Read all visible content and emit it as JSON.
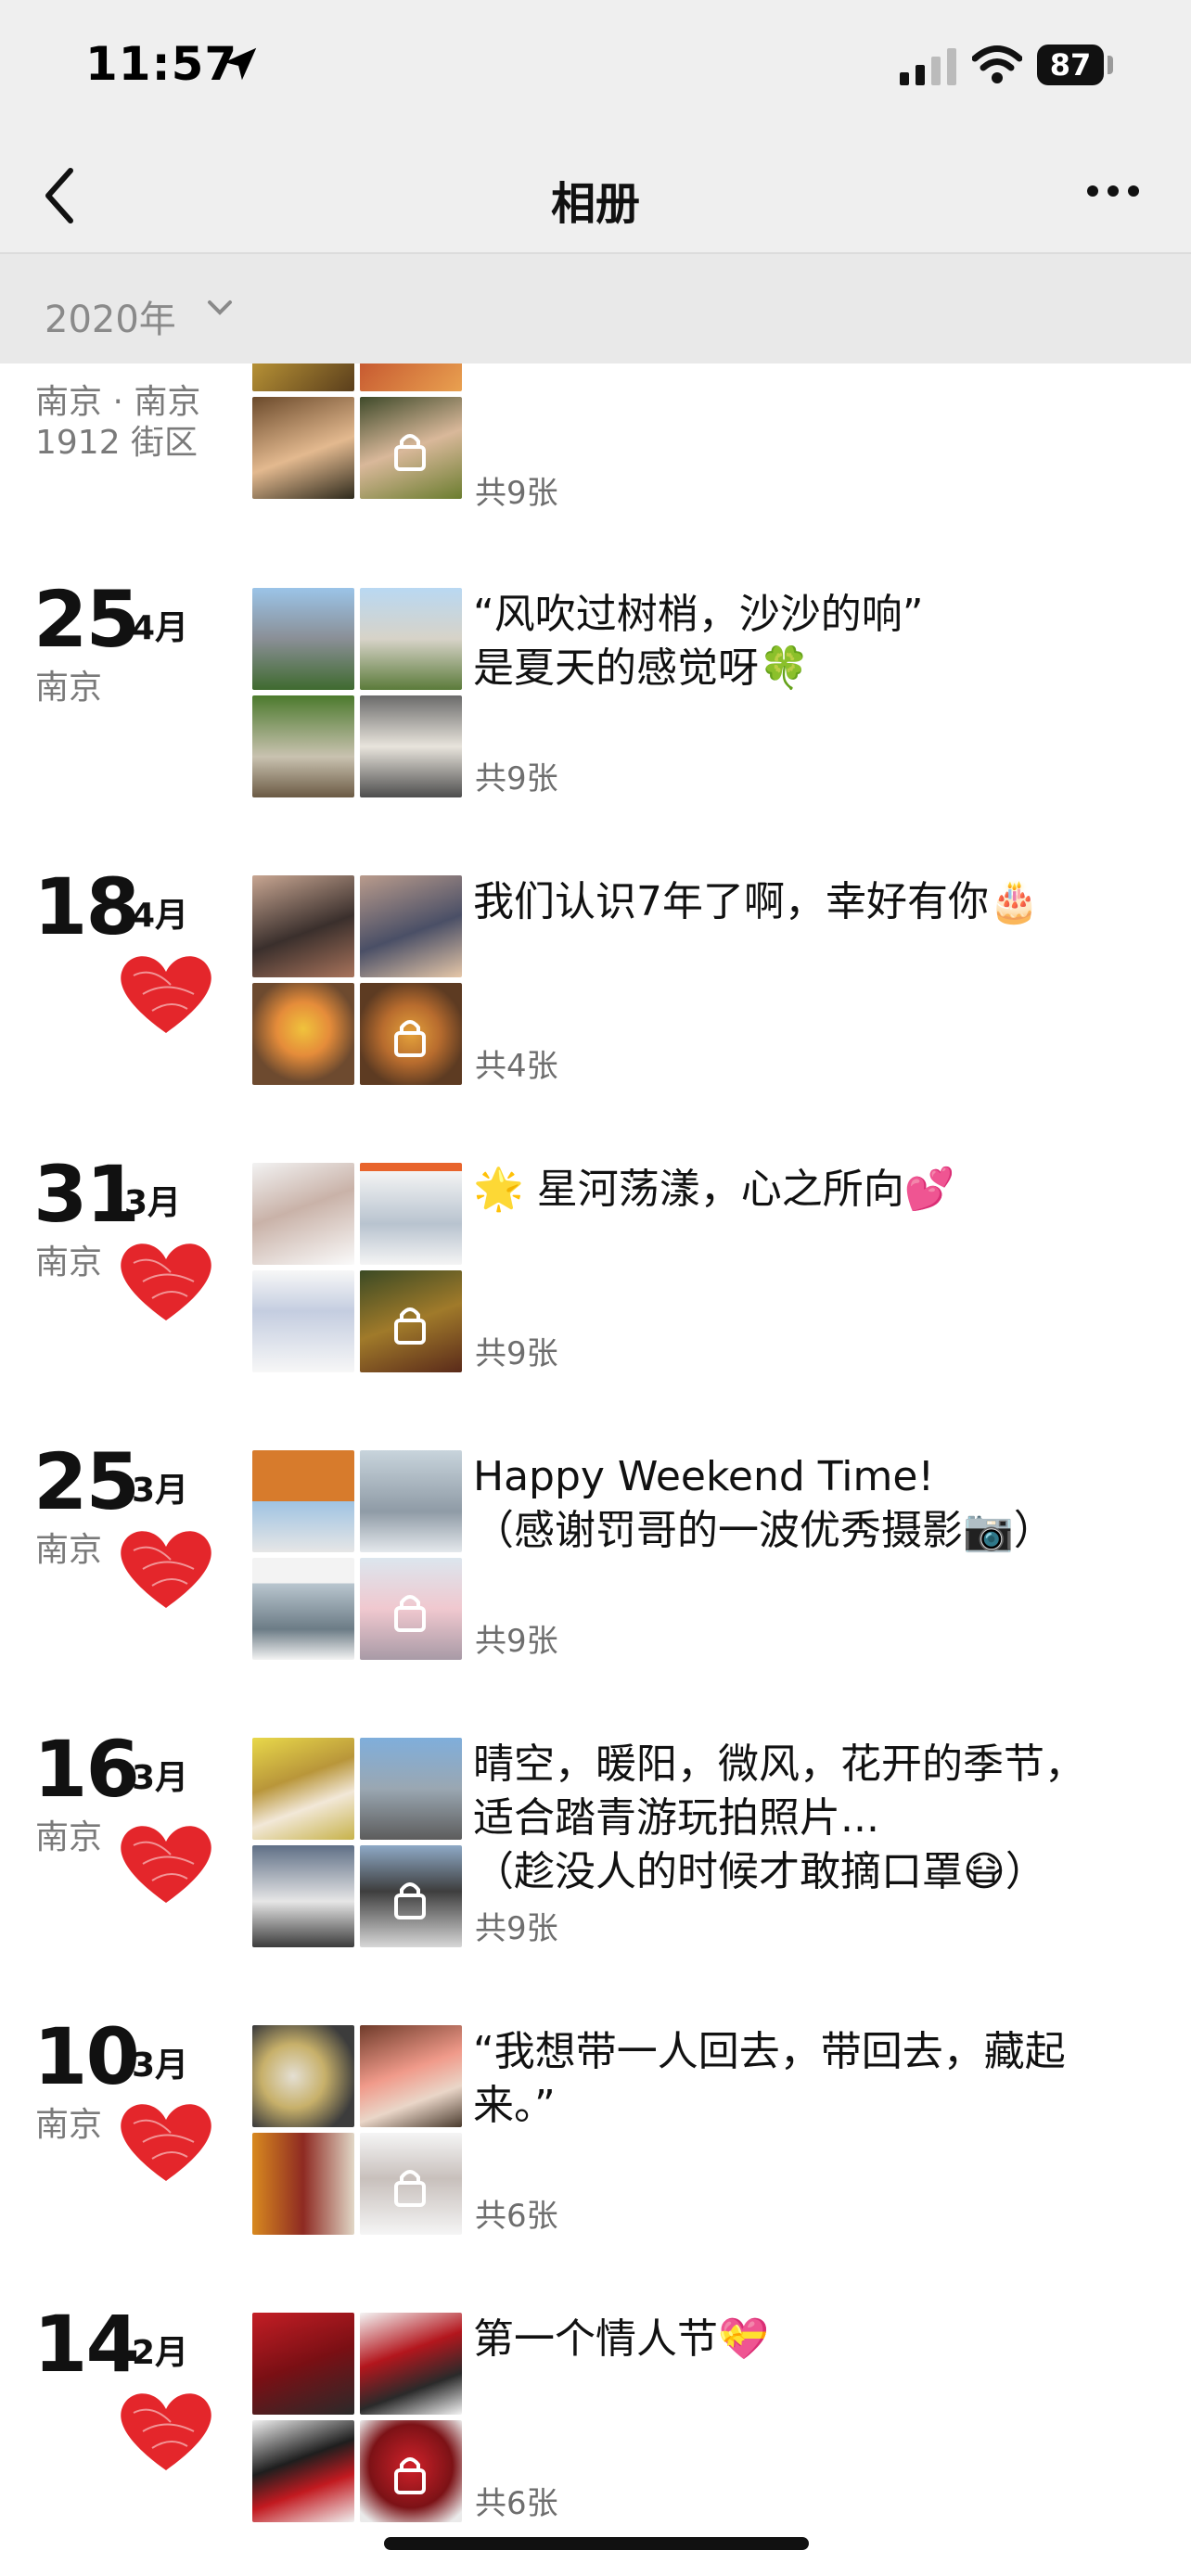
{
  "status_bar": {
    "time": "11:57",
    "battery": "87"
  },
  "nav": {
    "title": "相册",
    "back_icon": "chevron-left-icon",
    "more_icon": "more-dots-icon"
  },
  "year_filter": {
    "label": "2020年"
  },
  "colors": {
    "heart": "#e4262b",
    "header_bg": "#efefef"
  },
  "partial_entry": {
    "place_line1": "南京 · 南京",
    "place_line2": "1912 街区",
    "count": "共9张"
  },
  "entries": [
    {
      "day": "25",
      "month": "4月",
      "place": "南京",
      "heart": false,
      "caption": "“风吹过树梢，沙沙的响”\n是夏天的感觉呀🍀",
      "count": "共9张"
    },
    {
      "day": "18",
      "month": "4月",
      "place": "",
      "heart": true,
      "caption": "我们认识7年了啊，幸好有你🎂",
      "count": "共4张"
    },
    {
      "day": "31",
      "month": "3月",
      "place": "南京",
      "heart": true,
      "caption": "🌟 星河荡漾，心之所向💕",
      "count": "共9张"
    },
    {
      "day": "25",
      "month": "3月",
      "place": "南京",
      "heart": true,
      "caption": "Happy Weekend Time!\n（感谢罚哥的一波优秀摄影📷）",
      "count": "共9张"
    },
    {
      "day": "16",
      "month": "3月",
      "place": "南京",
      "heart": true,
      "caption": "晴空，暖阳，微风，花开的季节，\n适合踏青游玩拍照片...\n（趁没人的时候才敢摘口罩😷）",
      "count": "共9张"
    },
    {
      "day": "10",
      "month": "3月",
      "place": "南京",
      "heart": true,
      "caption": "“我想带一人回去，带回去，藏起\n来。”",
      "count": "共6张"
    },
    {
      "day": "14",
      "month": "2月",
      "place": "",
      "heart": true,
      "caption": "第一个情人节💝",
      "count": "共6张"
    }
  ]
}
